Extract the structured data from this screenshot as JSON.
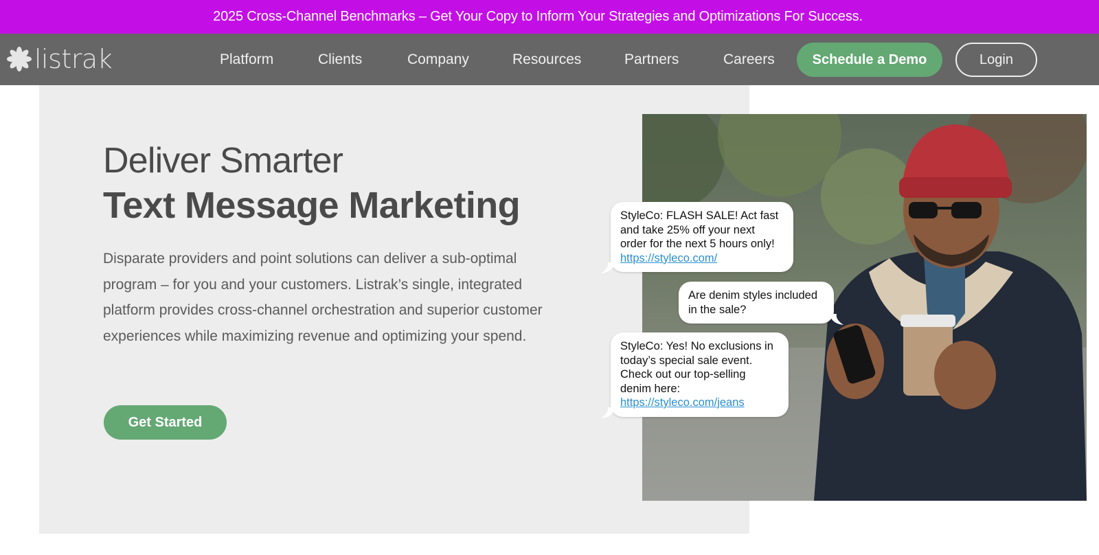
{
  "promo_banner": {
    "text": "2025 Cross-Channel Benchmarks – Get Your Copy to Inform Your Strategies and Optimizations For Success.",
    "background": "#c40ee6"
  },
  "header": {
    "logo_text": "listrak",
    "logo_icon": "listrak-burst-icon",
    "nav": [
      {
        "label": "Platform"
      },
      {
        "label": "Clients"
      },
      {
        "label": "Company"
      },
      {
        "label": "Resources"
      },
      {
        "label": "Partners"
      },
      {
        "label": "Careers"
      }
    ],
    "demo_button": "Schedule a Demo",
    "login_button": "Login",
    "background": "#666666",
    "accent": "#64a874"
  },
  "hero": {
    "headline_light": "Deliver Smarter",
    "headline_bold": "Text Message Marketing",
    "body": "Disparate providers and point solutions can deliver a sub-optimal program – for you and your customers. Listrak’s single, integrated platform provides cross-channel orchestration and superior customer experiences while maximizing revenue and optimizing your spend.",
    "cta": "Get Started"
  },
  "chat": {
    "message1": {
      "text": "StyleCo: FLASH SALE! Act fast and take 25% off your next order for the next 5 hours only!",
      "link": "https://styleco.com/"
    },
    "message2": {
      "text": "Are denim styles included in the sale?"
    },
    "message3": {
      "text": "StyleCo: Yes! No exclusions in today’s special sale event. Check out our top-selling denim here:",
      "link": "https://styleco.com/jeans"
    }
  }
}
